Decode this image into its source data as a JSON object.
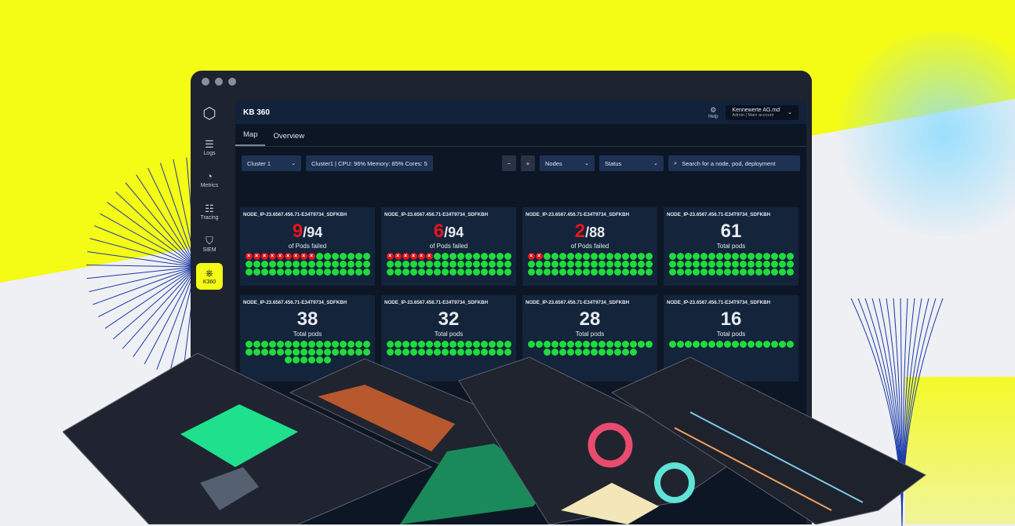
{
  "colors": {
    "accent_yellow": "#f4fb14",
    "pod_ok": "#1fdc3b",
    "pod_failed": "#e8141e",
    "panel": "#13243b"
  },
  "sidebar": {
    "logo_icon": "cube-logo-icon",
    "items": [
      {
        "label": "Logs",
        "icon": "logs-icon",
        "active": false
      },
      {
        "label": "Metrics",
        "icon": "gauge-icon",
        "active": false
      },
      {
        "label": "Tracing",
        "icon": "tracing-icon",
        "active": false
      },
      {
        "label": "SIEM",
        "icon": "shield-icon",
        "active": false
      },
      {
        "label": "K360",
        "icon": "kubernetes-icon",
        "active": true
      }
    ]
  },
  "header": {
    "title": "KB 360",
    "help_label": "Help",
    "account_name": "Kennewerte AG.md",
    "account_role": "Admin  |  Main account"
  },
  "tabs": [
    {
      "label": "Map",
      "active": true
    },
    {
      "label": "Overview",
      "active": false
    }
  ],
  "toolbar": {
    "cluster_select": "Cluster 1",
    "cluster_info": "Cluster1 | CPU: 96%  Memory: 85%  Cores: 5",
    "zoom_out": "−",
    "zoom_in": "+",
    "nodes_select": "Nodes",
    "status_select": "Status",
    "search_placeholder": "Search for a node, pod, deployment"
  },
  "nodes": [
    {
      "name": "NODE_IP-23.6567.456.71-E34T9734_SDFKBH",
      "failed": "9",
      "total": "/94",
      "label": "of Pods failed"
    },
    {
      "name": "NODE_IP-23.6567.456.71-E34T9734_SDFKBH",
      "failed": "6",
      "total": "/94",
      "label": "of Pods failed"
    },
    {
      "name": "NODE_IP-23.6567.456.71-E34T9734_SDFKBH",
      "failed": "2",
      "total": "/88",
      "label": "of Pods failed"
    },
    {
      "name": "NODE_IP-23.6567.456.71-E34T9734_SDFKBH",
      "count": "61",
      "label": "Total pods"
    },
    {
      "name": "NODE_IP-23.6567.456.71-E34T9734_SDFKBH",
      "count": "38",
      "label": "Total pods"
    },
    {
      "name": "NODE_IP-23.6567.456.71-E34T9734_SDFKBH",
      "count": "32",
      "label": "Total pods"
    },
    {
      "name": "NODE_IP-23.6567.456.71-E34T9734_SDFKBH",
      "count": "28",
      "label": "Total pods"
    },
    {
      "name": "NODE_IP-23.6567.456.71-E34T9734_SDFKBH",
      "count": "16",
      "label": "Total pods"
    }
  ]
}
